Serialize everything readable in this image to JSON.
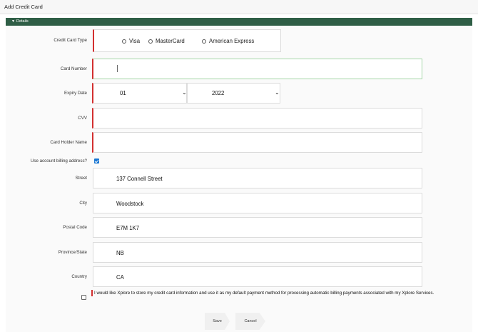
{
  "window": {
    "title": "Add Credit Card"
  },
  "section": {
    "label": "Details",
    "toggle_icon": "triangle-down-icon"
  },
  "form": {
    "card_type_label": "Credit Card Type",
    "card_type_options": [
      "Visa",
      "MasterCard",
      "American Express"
    ],
    "card_number_label": "Card Number",
    "card_number_value": "",
    "expiry_label": "Expiry Date",
    "expiry_month": "01",
    "expiry_year": "2022",
    "cvv_label": "CVV",
    "cvv_value": "",
    "holder_label": "Card Holder Name",
    "holder_value": "",
    "billing_label": "Use account billing address?",
    "billing_checked": true,
    "street_label": "Street",
    "street_value": "137 Connell Street",
    "city_label": "City",
    "city_value": "Woodstock",
    "postal_label": "Postal Code",
    "postal_value": "E7M 1K7",
    "province_label": "Province/State",
    "province_value": "NB",
    "country_label": "Country",
    "country_value": "CA",
    "consent_checked": false,
    "consent_text": "I would like Xplore to store my credit card information and use it as my default payment method for processing automatic billing payments associated with my Xplore Services."
  },
  "buttons": {
    "save": "Save",
    "cancel": "Cancel"
  },
  "colors": {
    "section_bar": "#2f5e46",
    "required_marker": "#d32f2f",
    "checkbox": "#1976d2",
    "focus_border": "#a5d6a7"
  }
}
